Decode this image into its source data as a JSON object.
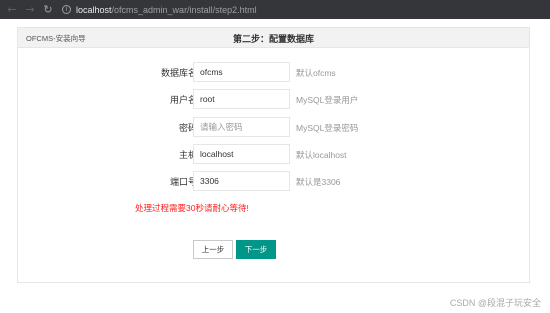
{
  "browser": {
    "back_glyph": "←",
    "forward_glyph": "→",
    "reload_glyph": "↻",
    "info_glyph": "i",
    "url_host": "localhost",
    "url_path": "/ofcms_admin_war/install/step2.html"
  },
  "header": {
    "brand": "OFCMS-安装向导",
    "step_title": "第二步：配置数据库"
  },
  "form": {
    "fields": [
      {
        "label": "数据库名",
        "value": "ofcms",
        "placeholder": "",
        "hint": "默认ofcms"
      },
      {
        "label": "用户名",
        "value": "root",
        "placeholder": "",
        "hint": "MySQL登录用户"
      },
      {
        "label": "密码",
        "value": "",
        "placeholder": "请输入密码",
        "hint": "MySQL登录密码"
      },
      {
        "label": "主机",
        "value": "localhost",
        "placeholder": "",
        "hint": "默认localhost"
      },
      {
        "label": "端口号",
        "value": "3306",
        "placeholder": "",
        "hint": "默认是3306"
      }
    ],
    "warning": "处理过程需要30秒请耐心等待!"
  },
  "buttons": {
    "prev": "上一步",
    "next": "下一步"
  },
  "watermark": "CSDN @段混子玩安全",
  "colors": {
    "accent": "#009688",
    "warning": "#ff2222"
  }
}
